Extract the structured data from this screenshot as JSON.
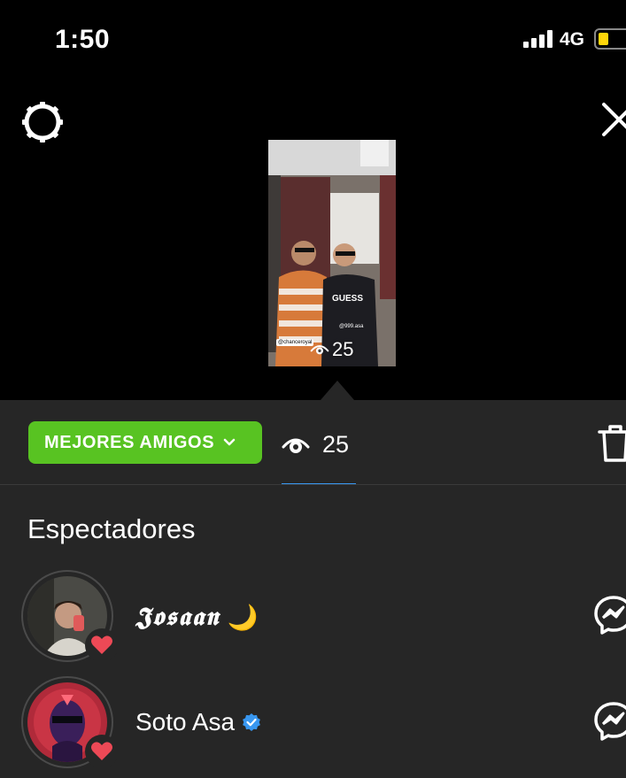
{
  "status_bar": {
    "time": "1:50",
    "network": "4G",
    "battery_level": 0.3,
    "battery_color": "#ffd60a"
  },
  "story": {
    "view_count": "25",
    "tag_left": "@chanceroyal",
    "tag_right": "@999.asa"
  },
  "panel": {
    "audience_label": "MEJORES AMIGOS",
    "audience_color": "#58c322",
    "views_count": "25",
    "viewers_title": "Espectadores",
    "tab_accent": "#3897f0"
  },
  "viewers": [
    {
      "name": "𝕵𝖔𝖘𝖆𝖆𝖓",
      "emoji": "🌙",
      "close_friend": true,
      "verified": false
    },
    {
      "name": "Soto Asa",
      "emoji": "",
      "close_friend": true,
      "verified": true
    }
  ],
  "icons": {
    "settings": "gear-icon",
    "close": "close-icon",
    "eye": "eye-icon",
    "trash": "trash-icon",
    "messenger": "messenger-icon",
    "heart": "heart-icon",
    "verified": "verified-badge-icon",
    "chevron": "chevron-down-icon"
  }
}
